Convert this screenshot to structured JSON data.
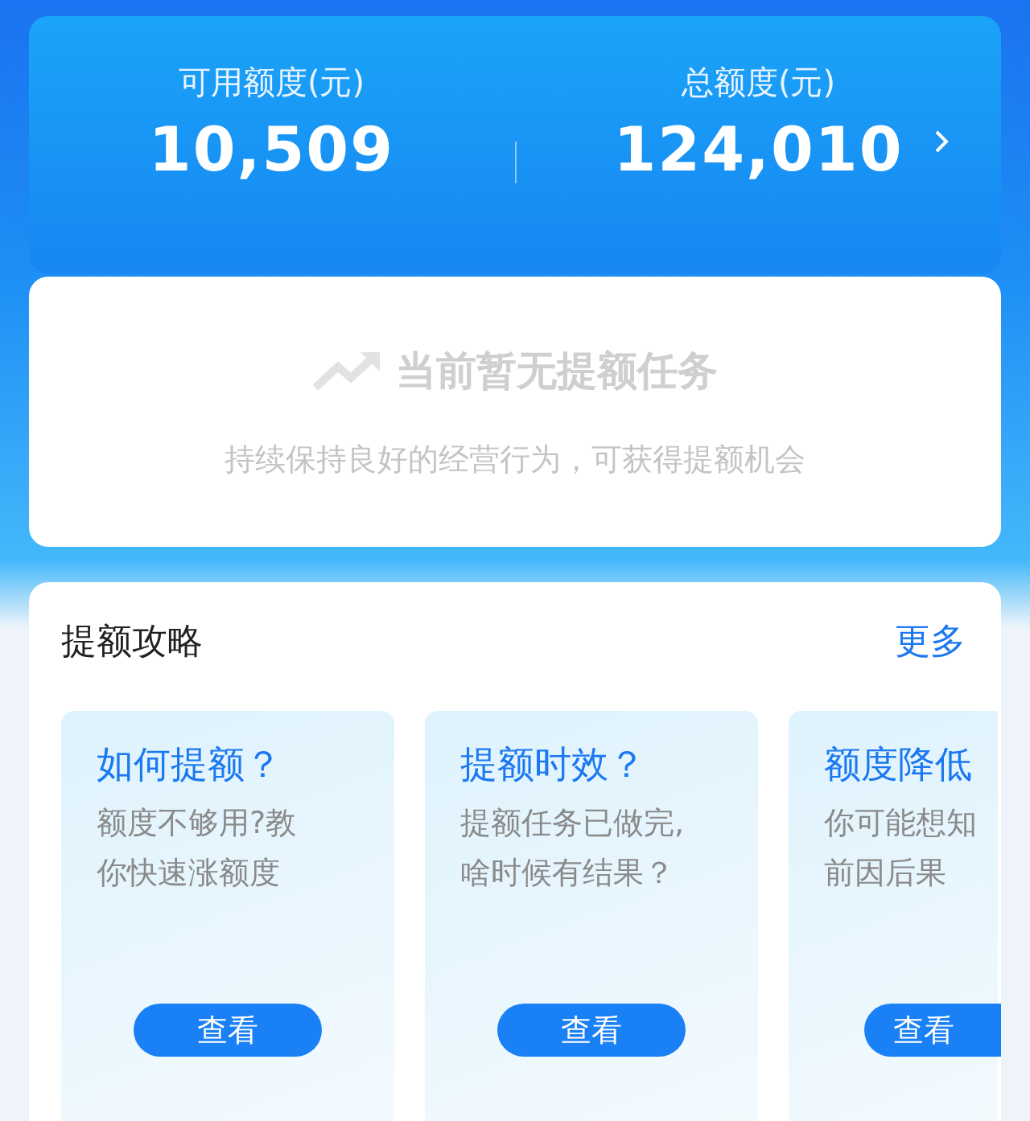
{
  "summary": {
    "stats": [
      {
        "label": "可用额度(元)",
        "value": "10,509"
      },
      {
        "label": "总额度(元)",
        "value": "124,010"
      }
    ]
  },
  "task_card": {
    "title": "当前暂无提额任务",
    "subtitle": "持续保持良好的经营行为，可获得提额机会"
  },
  "guide": {
    "title": "提额攻略",
    "more": "更多",
    "cards": [
      {
        "title": "如何提额？",
        "lines": [
          "额度不够用?教",
          "你快速涨额度"
        ],
        "button": "查看"
      },
      {
        "title": "提额时效？",
        "lines": [
          "提额任务已做完,",
          "啥时候有结果？"
        ],
        "button": "查看"
      },
      {
        "title": "额度降低",
        "lines": [
          "你可能想知",
          "前因后果"
        ],
        "button": "查看"
      }
    ]
  }
}
